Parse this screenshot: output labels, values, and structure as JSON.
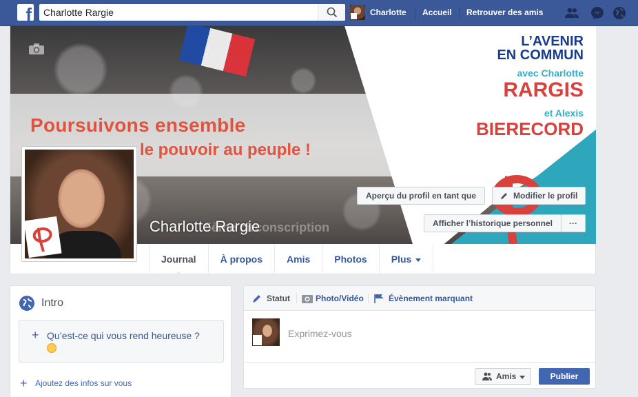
{
  "topbar": {
    "logo": "f",
    "search_value": "Charlotte Rargie",
    "search_icon": "search-icon",
    "user_name": "Charlotte",
    "home": "Accueil",
    "find_friends": "Retrouver des amis",
    "icons": [
      "friend-requests-icon",
      "messenger-icon",
      "notifications-globe-icon"
    ],
    "brand_color": "#3b5998"
  },
  "cover": {
    "slogan_line1": "Poursuivons ensemble",
    "slogan_line2": "le pouvoir au peuple !",
    "subtext": "5ème circonscription",
    "headline_line1": "L’AVENIR",
    "headline_line2": "EN COMMUN",
    "with_label": "avec Charlotte",
    "candidate1": "RARGIS",
    "and_label": "et Alexis",
    "candidate2": "BIERECORD",
    "btn_view_as": "Aperçu du profil en tant que",
    "btn_edit": "Modifier le profil",
    "btn_history": "Afficher l’historique personnel",
    "btn_more": "···"
  },
  "profile": {
    "name": "Charlotte Rargie"
  },
  "tabs": [
    {
      "label": "Journal"
    },
    {
      "label": "À propos"
    },
    {
      "label": "Amis"
    },
    {
      "label": "Photos"
    },
    {
      "label": "Plus"
    }
  ],
  "intro": {
    "title": "Intro",
    "question": "Qu’est-ce qui vous rend heureuse ?",
    "add_info": "Ajoutez des infos sur vous"
  },
  "composer": {
    "tab_status": "Statut",
    "tab_photo": "Photo/Vidéo",
    "tab_event": "Évènement marquant",
    "placeholder": "Exprimez-vous",
    "audience": "Amis",
    "publish": "Publier"
  }
}
